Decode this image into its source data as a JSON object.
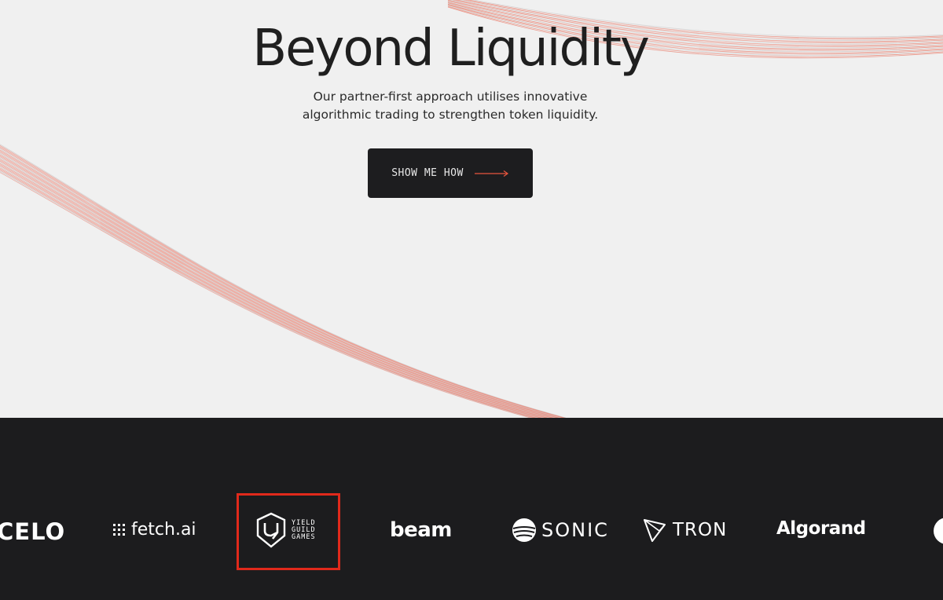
{
  "hero": {
    "title": "Beyond Liquidity",
    "subtitle": "Our partner-first approach utilises innovative algorithmic trading to strengthen token liquidity.",
    "cta_label": "SHOW ME HOW",
    "cta_icon": "arrow-right-icon"
  },
  "partners": {
    "logos": [
      {
        "name": "celo",
        "text": "CELO"
      },
      {
        "name": "fetch-ai",
        "text": "fetch.ai"
      },
      {
        "name": "yield-guild-games",
        "lines": [
          "YIELD",
          "GUILD",
          "GAMES"
        ]
      },
      {
        "name": "beam",
        "text": "beam"
      },
      {
        "name": "sonic",
        "text": "SONIC"
      },
      {
        "name": "tron",
        "text": "TRON"
      },
      {
        "name": "algorand",
        "text": "Algorand"
      }
    ]
  },
  "colors": {
    "background": "#f0f0f0",
    "dark_band": "#1c1c1e",
    "accent": "#e8553e",
    "highlight_box": "#e0291b",
    "text_dark": "#1f1f1f",
    "logo_white": "#ffffff"
  }
}
